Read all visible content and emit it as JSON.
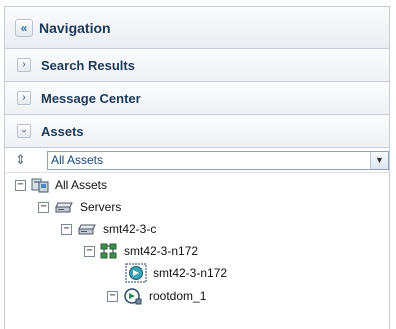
{
  "navigation": {
    "title": "Navigation",
    "collapse_glyph": "«"
  },
  "sections": [
    {
      "label": "Search Results",
      "state_glyph": "›",
      "expanded": false
    },
    {
      "label": "Message Center",
      "state_glyph": "›",
      "expanded": false
    },
    {
      "label": "Assets",
      "state_glyph": "›",
      "expanded": true
    }
  ],
  "assets_toolbar": {
    "refresh_glyph": "⇕",
    "filter_value": "All Assets",
    "dropdown_glyph": "▼"
  },
  "tree": [
    {
      "label": "All Assets",
      "icon": "asset-group-icon",
      "expander": "−"
    },
    {
      "label": "Servers",
      "icon": "server-group-icon",
      "expander": "−"
    },
    {
      "label": "smt42-3-c",
      "icon": "server-icon",
      "expander": "−"
    },
    {
      "label": "smt42-3-n172",
      "icon": "system-topology-icon",
      "expander": "−"
    },
    {
      "label": "smt42-3-n172",
      "icon": "global-zone-icon",
      "expander": ""
    },
    {
      "label": "rootdom_1",
      "icon": "logical-domain-icon",
      "expander": "−"
    }
  ],
  "colors": {
    "title_text": "#1d3a5c",
    "select_text": "#16477f",
    "border": "#c6ccd6"
  }
}
